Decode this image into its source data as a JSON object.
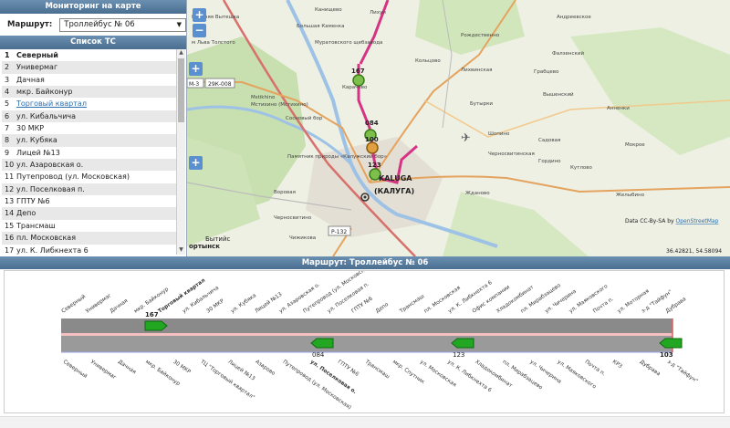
{
  "left": {
    "title": "Мониторинг на карте",
    "route_label": "Маршрут:",
    "route_value": "Троллейбус № 06",
    "list_title": "Список ТС",
    "stops": [
      {
        "n": "1",
        "name": "Северный"
      },
      {
        "n": "2",
        "name": "Универмаг"
      },
      {
        "n": "3",
        "name": "Дачная"
      },
      {
        "n": "4",
        "name": "мкр. Байконур"
      },
      {
        "n": "5",
        "name": "Торговый квартал"
      },
      {
        "n": "6",
        "name": "ул. Кибальчича"
      },
      {
        "n": "7",
        "name": "30 МКР"
      },
      {
        "n": "8",
        "name": "ул. Кубяка"
      },
      {
        "n": "9",
        "name": "Лицей №13"
      },
      {
        "n": "10",
        "name": "ул. Азаровская о."
      },
      {
        "n": "11",
        "name": "Путепровод (ул. Московская)"
      },
      {
        "n": "12",
        "name": "ул. Поселковая п."
      },
      {
        "n": "13",
        "name": "ГПТУ №6"
      },
      {
        "n": "14",
        "name": "Депо"
      },
      {
        "n": "15",
        "name": "Трансмаш"
      },
      {
        "n": "16",
        "name": "пл. Московская"
      },
      {
        "n": "17",
        "name": "ул. К. Либкнехта 6"
      }
    ]
  },
  "map": {
    "road_labels": [
      "М-3",
      "29К-008",
      "Р-132"
    ],
    "places": [
      "Карачево",
      "Муратовского щебзавода",
      "Мстихино (Мстихино)",
      "Сосновый бор",
      "Памятник природы «Калужский бор»",
      "Воровая",
      "Черносвитино",
      "Чижикова",
      "Чижикова",
      "Канищево",
      "Лихун",
      "Кольцово",
      "Рождественно",
      "Грабцево",
      "Андреевское",
      "Бутырки",
      "Лихвинская",
      "Шопино",
      "Черносвитинская",
      "Садовая",
      "Вышенский",
      "Анненки",
      "Гордино",
      "Жданово",
      "Мокрое",
      "Желыбино",
      "Кутлово",
      "Фалзенский"
    ],
    "city": "KALUGA (КАЛУГА)",
    "city_lat": "KALUGA",
    "city_ru": "(КАЛУГА)",
    "attribution_prefix": "Data CC-By-SA by ",
    "attribution_link": "OpenStreetMap",
    "coords": "36.42821, 54.58094",
    "extra": "Бытийс",
    "extra2": "ортынск",
    "extra3": "Большая Каменка",
    "extra4": "Верхняя Вытешка",
    "extra5": "м Льва Толстого",
    "vehicles": [
      "167",
      "084",
      "123",
      "100"
    ]
  },
  "bottom": {
    "title": "Маршрут: Троллейбус № 06",
    "top_labels": [
      "Северный",
      "Универмаг",
      "Дачная",
      "мкр. Байконур",
      "Торговый квартал",
      "ул. Кибальчича",
      "30 МКР",
      "ул. Кубяка",
      "Лицей №13",
      "ул. Азаровская о.",
      "Путепровод (ул. Московская)",
      "ул. Поселковая п.",
      "ГПТУ №6",
      "Депо",
      "Трансмаш",
      "пл. Московская",
      "ул. К. Либкнехта 6",
      "Офис компании",
      "Хладокомбинат",
      "пл. Мирабзацево",
      "ул. Чичерина",
      "ул. Маяковского",
      "Почта п.",
      "ул. Моторная",
      "з-д \"Тайфун\"",
      "Дубрава"
    ],
    "bottom_labels": [
      "Северный",
      "Универмаг",
      "Дачная",
      "мкр. Байконур",
      "30 МКР",
      "ТЦ \"Торговый квартал\"",
      "Лицей №13",
      "Азарово",
      "Путепровод (ул. Московская)",
      "ул. Поселковая о.",
      "ГПТУ №6",
      "Трансмаш",
      "мкр. Спутник",
      "ул. Московская",
      "ул. К. Либкнехта 6",
      "Хладокомбинат",
      "пл. Мирабзацево",
      "ул. Чичерина",
      "ул. Маяковского",
      "Почта п.",
      "КРЗ",
      "Дубрава",
      "з-д \"Тайфун\""
    ],
    "bus_top": [
      "167"
    ],
    "bus_bottom": [
      "084",
      "123",
      "103"
    ]
  },
  "colors": {
    "header": "#5b7fa3",
    "route": "#d63384",
    "bus": "#22a722"
  }
}
